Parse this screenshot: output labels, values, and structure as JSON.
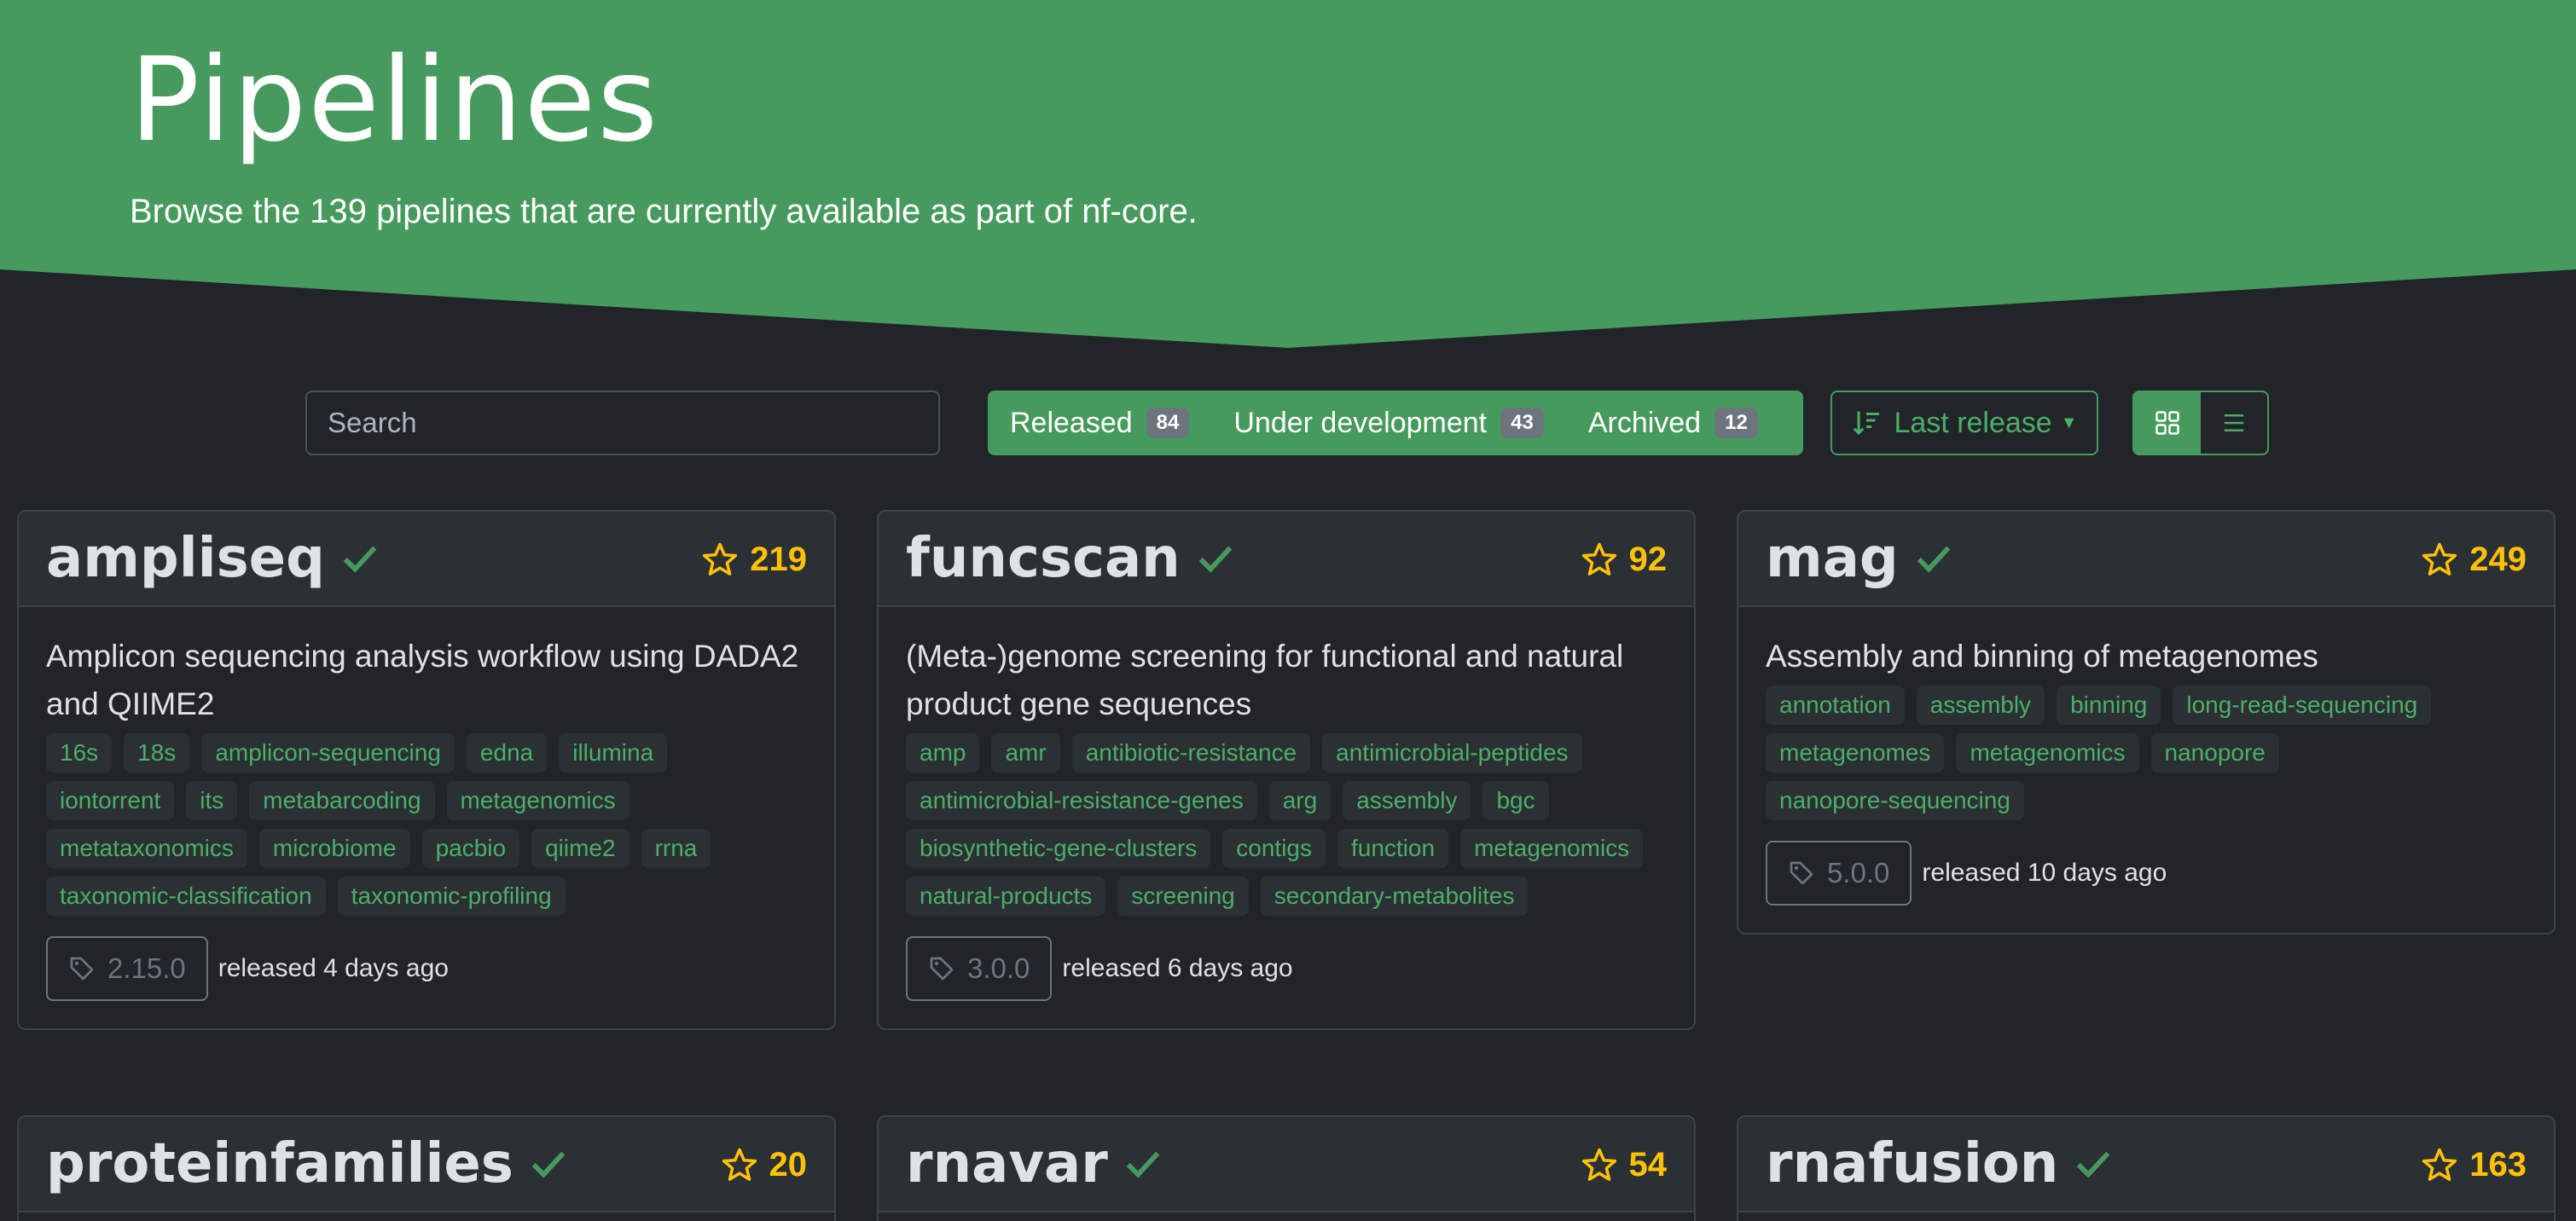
{
  "colors": {
    "accent": "#479a5e",
    "accent_text": "#4caf66",
    "star": "#ffc107",
    "background": "#212529"
  },
  "hero": {
    "title": "Pipelines",
    "subtitle": "Browse the 139 pipelines that are currently available as part of nf-core."
  },
  "toolbar": {
    "search_placeholder": "Search",
    "filters": [
      {
        "label": "Released",
        "count": "84"
      },
      {
        "label": "Under development",
        "count": "43"
      },
      {
        "label": "Archived",
        "count": "12"
      }
    ],
    "sort_label": "Last release",
    "view_modes": [
      "grid-icon",
      "list-icon"
    ]
  },
  "pipelines": [
    {
      "name": "ampliseq",
      "stars": "219",
      "description": "Amplicon sequencing analysis workflow using DADA2 and QIIME2",
      "topics": [
        "16s",
        "18s",
        "amplicon-sequencing",
        "edna",
        "illumina",
        "iontorrent",
        "its",
        "metabarcoding",
        "metagenomics",
        "metataxonomics",
        "microbiome",
        "pacbio",
        "qiime2",
        "rrna",
        "taxonomic-classification",
        "taxonomic-profiling"
      ],
      "version": "2.15.0",
      "released": "released 4 days ago"
    },
    {
      "name": "funcscan",
      "stars": "92",
      "description": "(Meta-)genome screening for functional and natural product gene sequences",
      "topics": [
        "amp",
        "amr",
        "antibiotic-resistance",
        "antimicrobial-peptides",
        "antimicrobial-resistance-genes",
        "arg",
        "assembly",
        "bgc",
        "biosynthetic-gene-clusters",
        "contigs",
        "function",
        "metagenomics",
        "natural-products",
        "screening",
        "secondary-metabolites"
      ],
      "version": "3.0.0",
      "released": "released 6 days ago"
    },
    {
      "name": "mag",
      "stars": "249",
      "description": "Assembly and binning of metagenomes",
      "topics": [
        "annotation",
        "assembly",
        "binning",
        "long-read-sequencing",
        "metagenomes",
        "metagenomics",
        "nanopore",
        "nanopore-sequencing"
      ],
      "version": "5.0.0",
      "released": "released 10 days ago"
    },
    {
      "name": "proteinfamilies",
      "stars": "20"
    },
    {
      "name": "rnavar",
      "stars": "54"
    },
    {
      "name": "rnafusion",
      "stars": "163"
    }
  ]
}
